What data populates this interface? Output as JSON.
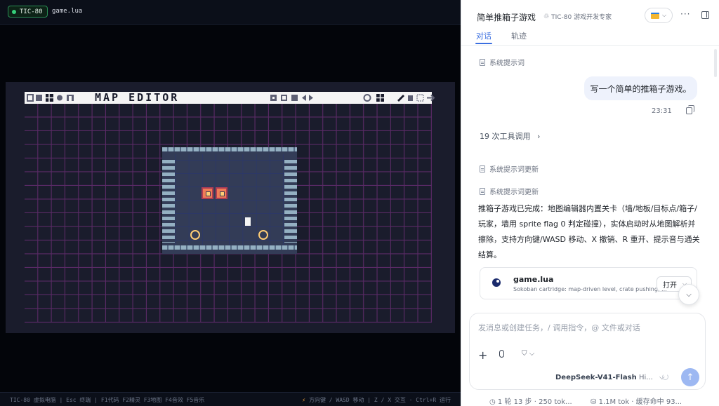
{
  "left": {
    "badge": "TIC-80",
    "filename": "game.lua",
    "toolbar_title": "MAP EDITOR",
    "status_left": "TIC-80 虚拟电脑 | Esc 终端 | F1代码 F2精灵 F3地图 F4音效 F5音乐",
    "status_right": "方向键 / WASD 移动 | Z / X 交互 · Ctrl+R 运行"
  },
  "colors": {
    "map_grid": "#5a2a66",
    "screen_bg": "#1a1c2c",
    "floor": "#333c57",
    "brick": "#94b0c2",
    "crate": "#ef7d57",
    "target": "#ffcd75",
    "accent": "#3b6fe0"
  },
  "header": {
    "title": "简单推箱子游戏",
    "subtitle": "TIC-80 游戏开发专家",
    "tabs": [
      {
        "label": "对话",
        "active": true
      },
      {
        "label": "轨迹",
        "active": false
      }
    ]
  },
  "chat": {
    "system_prompt": "系统提示词",
    "user_message": "写一个简单的推箱子游戏。",
    "time": "23:31",
    "tool_calls": "19 次工具调用",
    "system_update_1": "系统提示词更新",
    "system_update_2": "系统提示词更新",
    "answer": "推箱子游戏已完成：地图编辑器内置关卡（墙/地板/目标点/箱子/玩家，墙用 sprite flag 0 判定碰撞），实体启动时从地图解析并擦除，支持方向键/WASD 移动、X 撤销、R 重开、提示音与通关结算。",
    "file": {
      "name": "game.lua",
      "desc": "Sokoban cartridge: map-driven level, crate pushing, ...",
      "open": "打开"
    }
  },
  "composer": {
    "placeholder": "发消息或创建任务，/ 调用指令，@ 文件或对话",
    "model": "DeepSeek-V41-Flash",
    "model_suffix": "Hi..."
  },
  "footer": {
    "stats": "1 轮 13 步 · 250 tok...",
    "cache": "1.1M tok · 缓存命中 93..."
  }
}
